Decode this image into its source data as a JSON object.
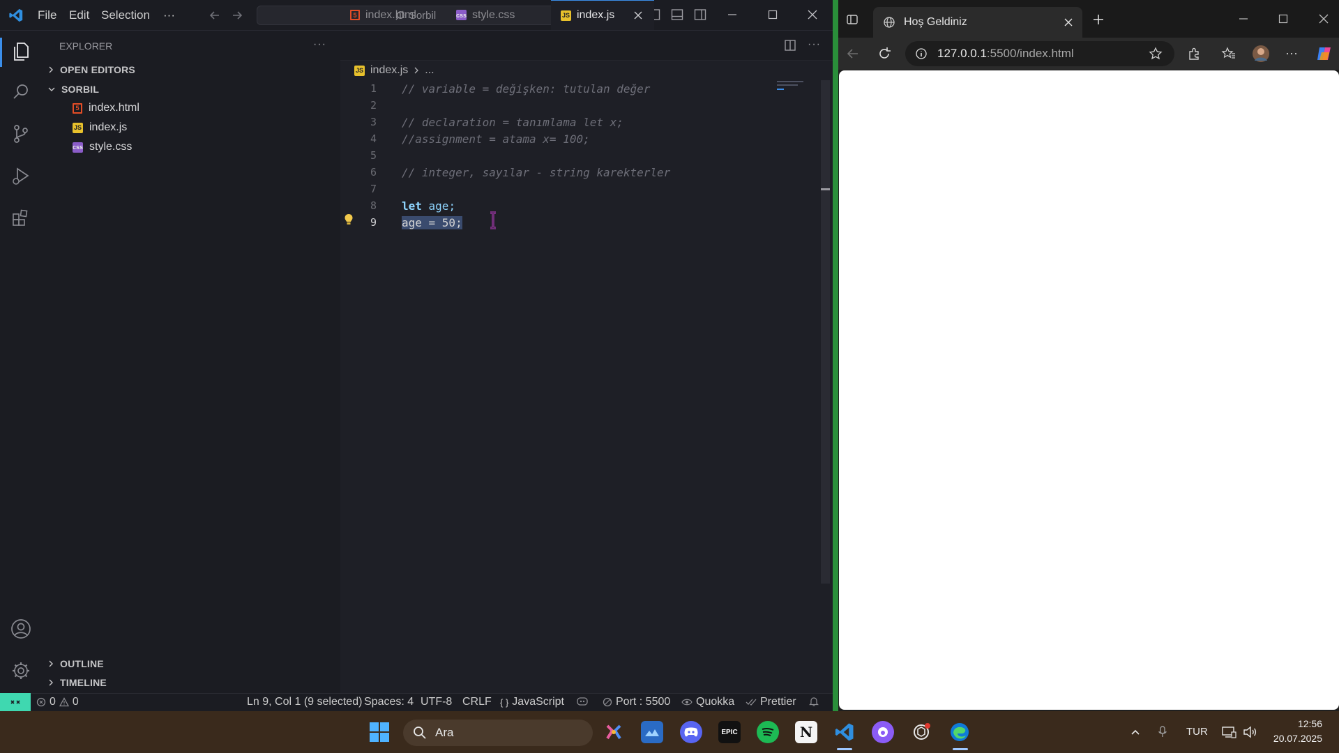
{
  "vscode": {
    "menu": [
      "File",
      "Edit",
      "Selection",
      "···"
    ],
    "search_label": "Sorbil",
    "explorer_title": "EXPLORER",
    "open_editors": "OPEN EDITORS",
    "project": "SORBIL",
    "files": [
      "index.html",
      "index.js",
      "style.css"
    ],
    "outline": "OUTLINE",
    "timeline": "TIMELINE",
    "tabs": [
      "index.html",
      "style.css",
      "index.js"
    ],
    "breadcrumb_file": "index.js",
    "breadcrumb_rest": "...",
    "lines": [
      {
        "n": "1",
        "text": "// variable = değişken: tutulan değer"
      },
      {
        "n": "2",
        "text": ""
      },
      {
        "n": "3",
        "text": "// declaration = tanımlama let x;"
      },
      {
        "n": "4",
        "text": "//assignment = atama x= 100;"
      },
      {
        "n": "5",
        "text": ""
      },
      {
        "n": "6",
        "text": "// integer, sayılar - string karekterler"
      },
      {
        "n": "7",
        "text": ""
      },
      {
        "n": "8",
        "kw": "let",
        "text": " age;"
      },
      {
        "n": "9",
        "text": "age = 50;"
      }
    ],
    "status": {
      "problems": "0",
      "warnings": "0",
      "position": "Ln 9, Col 1 (9 selected)",
      "spaces": "Spaces: 4",
      "encoding": "UTF-8",
      "eol": "CRLF",
      "language": "JavaScript",
      "port": "Port : 5500",
      "quokka": "Quokka",
      "prettier": "Prettier"
    }
  },
  "browser": {
    "tab_title": "Hoş Geldiniz",
    "url_host": "127.0.0.1",
    "url_rest": ":5500/index.html"
  },
  "taskbar": {
    "search_label": "Ara",
    "lang": "TUR",
    "time": "12:56",
    "date": "20.07.2025"
  },
  "colors": {
    "accent": "#3b8eea",
    "remote": "#3fd8b0",
    "keyword": "#8fd5ff",
    "comment": "#6d6e78"
  }
}
